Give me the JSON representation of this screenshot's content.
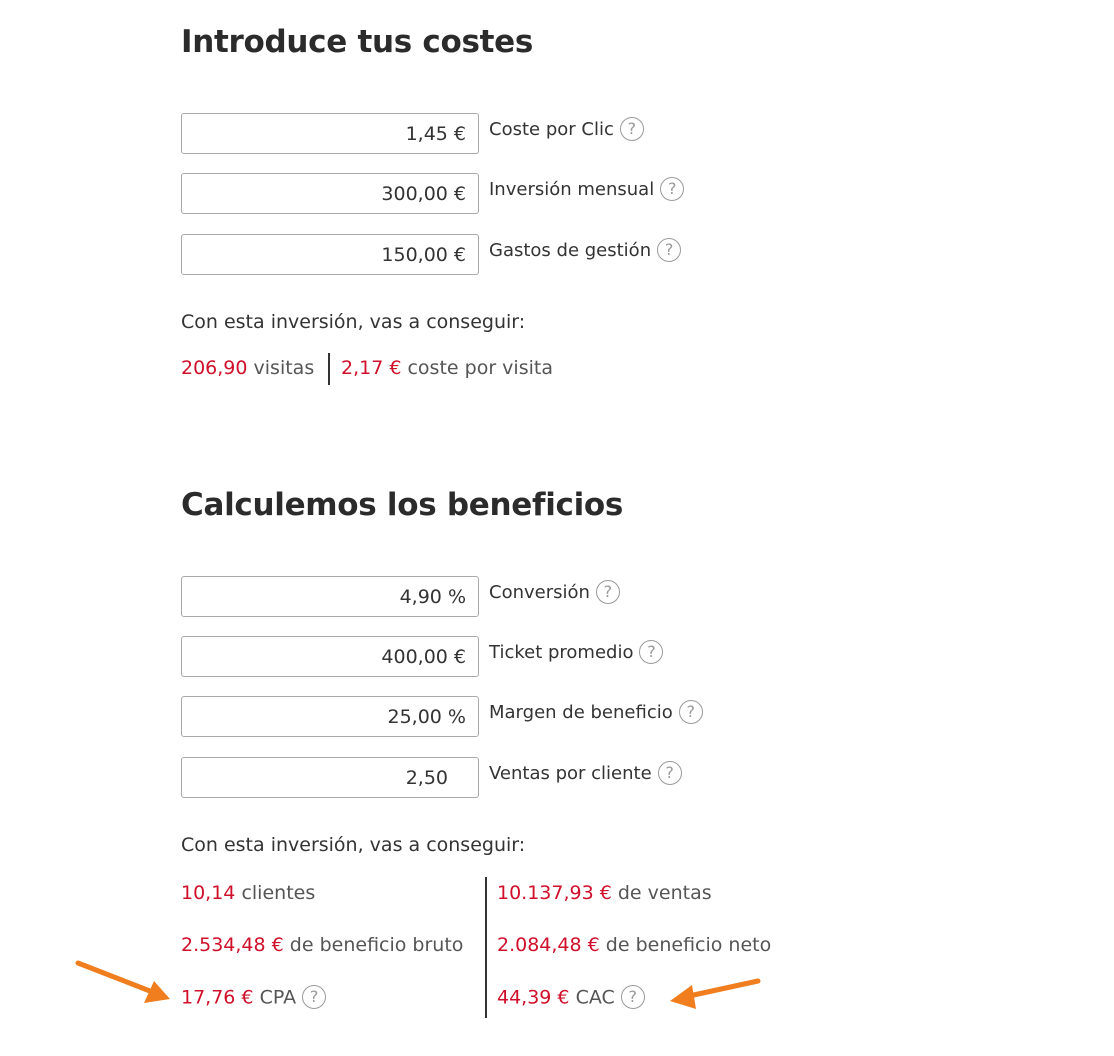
{
  "costs": {
    "title": "Introduce tus costes",
    "fields": [
      {
        "value": "1,45 €",
        "label": "Coste por Clic",
        "help": "?"
      },
      {
        "value": "300,00 €",
        "label": "Inversión mensual",
        "help": "?"
      },
      {
        "value": "150,00 €",
        "label": "Gastos de gestión",
        "help": "?"
      }
    ],
    "intro": "Con esta inversión, vas a conseguir:",
    "results": {
      "visits_value": "206,90",
      "visits_label": "visitas",
      "cpv_value": "2,17 €",
      "cpv_label": "coste por visita"
    }
  },
  "benefits": {
    "title": "Calculemos los beneficios",
    "fields": [
      {
        "value": "4,90 %",
        "label": "Conversión",
        "help": "?"
      },
      {
        "value": "400,00 €",
        "label": "Ticket promedio",
        "help": "?"
      },
      {
        "value": "25,00 %",
        "label": "Margen de beneficio",
        "help": "?"
      },
      {
        "value": "2,50",
        "label": "Ventas por cliente",
        "help": "?"
      }
    ],
    "intro": "Con esta inversión, vas a conseguir:",
    "results": {
      "clients_value": "10,14",
      "clients_label": "clientes",
      "sales_value": "10.137,93 €",
      "sales_label": "de ventas",
      "gross_value": "2.534,48 €",
      "gross_label": "de beneficio bruto",
      "net_value": "2.084,48 €",
      "net_label": "de beneficio neto",
      "cpa_value": "17,76 €",
      "cpa_label": "CPA",
      "cac_value": "44,39 €",
      "cac_label": "CAC",
      "help": "?"
    }
  },
  "colors": {
    "accent_red": "#d0102a",
    "annotation_arrow": "#f07e1e"
  }
}
